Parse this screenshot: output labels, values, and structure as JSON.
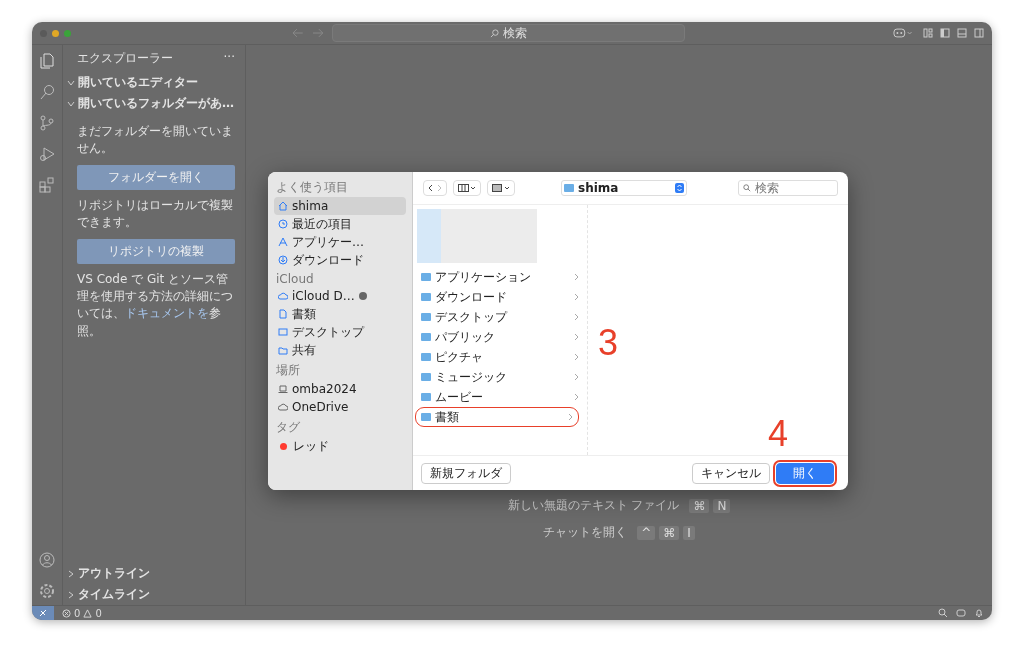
{
  "titlebar": {
    "search_placeholder": "検索"
  },
  "sidebar": {
    "title": "エクスプローラー",
    "more": "···",
    "sections": [
      {
        "label": "開いているエディター",
        "expanded": true
      },
      {
        "label": "開いているフォルダーがあ…",
        "expanded": true
      }
    ],
    "texts": [
      {
        "kind": "text",
        "text": "まだフォルダーを開いていません。"
      },
      {
        "kind": "button",
        "text": "フォルダーを開く"
      },
      {
        "kind": "text",
        "text": "リポジトリはローカルで複製できます。"
      },
      {
        "kind": "button",
        "text": "リポジトリの複製"
      },
      {
        "kind": "link",
        "text": "VS Code で Git とソース管理を使用する方法の詳細については、",
        "link": "ドキュメントを",
        "after": "参照。"
      }
    ],
    "bottom_sections": [
      {
        "label": "アウトライン",
        "expanded": false
      },
      {
        "label": "タイムライン",
        "expanded": false
      }
    ]
  },
  "editor_hints": [
    {
      "label": "新しい無題のテキスト ファイル",
      "keys": [
        "⌘",
        "N"
      ]
    },
    {
      "label": "チャットを開く",
      "keys": [
        "^",
        "⌘",
        "I"
      ]
    }
  ],
  "status_bar": {
    "errors": "0",
    "warnings": "0"
  },
  "dialog": {
    "groups": [
      {
        "title": "よく使う項目",
        "items": [
          {
            "label": "shima",
            "kind": "home",
            "selected": true
          },
          {
            "label": "最近の項目",
            "kind": "clock",
            "selected": false
          },
          {
            "label": "アプリケー…",
            "kind": "apps",
            "selected": false
          },
          {
            "label": "ダウンロード",
            "kind": "download",
            "selected": false
          }
        ]
      },
      {
        "title": "iCloud",
        "items": [
          {
            "label": "iCloud D…",
            "kind": "icloud",
            "selected": false
          },
          {
            "label": "書類",
            "kind": "doc",
            "selected": false
          },
          {
            "label": "デスクトップ",
            "kind": "desktop",
            "selected": false
          },
          {
            "label": "共有",
            "kind": "shared",
            "selected": false
          }
        ]
      },
      {
        "title": "場所",
        "items": [
          {
            "label": "omba2024",
            "kind": "laptop",
            "selected": false
          },
          {
            "label": "OneDrive",
            "kind": "cloud",
            "selected": false
          }
        ]
      },
      {
        "title": "タグ",
        "items": [
          {
            "label": "レッド",
            "kind": "tag",
            "color": "#ff3b30",
            "selected": false
          }
        ]
      }
    ],
    "path": "shima",
    "search_placeholder": "検索",
    "files": [
      {
        "name": "アプリケーション",
        "highlighted": false
      },
      {
        "name": "ダウンロード",
        "highlighted": false
      },
      {
        "name": "デスクトップ",
        "highlighted": false
      },
      {
        "name": "パブリック",
        "highlighted": false
      },
      {
        "name": "ピクチャ",
        "highlighted": false
      },
      {
        "name": "ミュージック",
        "highlighted": false
      },
      {
        "name": "ムービー",
        "highlighted": false
      },
      {
        "name": "書類",
        "highlighted": true
      }
    ],
    "buttons": [
      {
        "label": "新規フォルダ",
        "kind": "secondary",
        "highlighted": false
      },
      {
        "label": "キャンセル",
        "kind": "secondary",
        "highlighted": false
      },
      {
        "label": "開く",
        "kind": "primary",
        "highlighted": true
      }
    ]
  },
  "annotations": [
    {
      "label": "3",
      "kind": "files"
    },
    {
      "label": "4",
      "kind": "buttons"
    }
  ]
}
